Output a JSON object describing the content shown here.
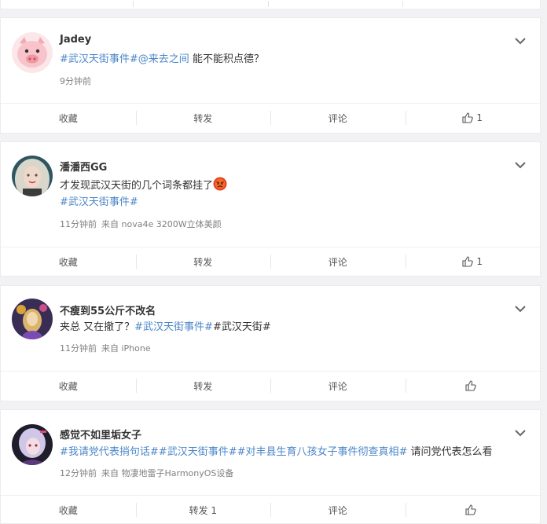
{
  "posts": [
    {
      "user": "Jadey",
      "text": [
        {
          "t": "#武汉天街事件#",
          "tag": true
        },
        {
          "t": "@来去之间",
          "tag": true
        },
        {
          "t": " 能不能积点德？",
          "tag": false
        }
      ],
      "time": "9分钟前",
      "source": "",
      "actions": {
        "fav": "收藏",
        "repost": "转发",
        "comment": "评论",
        "like": "1"
      }
    },
    {
      "user": "潘潘西GG",
      "text": [
        {
          "t": "才发现武汉天街的几个词条都挂了",
          "tag": false
        }
      ],
      "text2": "#武汉天街事件#",
      "emoji": "angry-face",
      "time": "11分钟前",
      "source": "来自 nova4e 3200W立体美颜",
      "actions": {
        "fav": "收藏",
        "repost": "转发",
        "comment": "评论",
        "like": "1"
      }
    },
    {
      "user": "不瘦到55公斤不改名",
      "text": [
        {
          "t": "夹总 又在撤了？",
          "tag": false
        },
        {
          "t": "#武汉天街事件#",
          "tag": true
        },
        {
          "t": "#武汉天街#",
          "tag": false
        }
      ],
      "time": "11分钟前",
      "source": "来自 iPhone",
      "actions": {
        "fav": "收藏",
        "repost": "转发",
        "comment": "评论",
        "like": ""
      }
    },
    {
      "user": "感觉不如里垢女子",
      "text": [
        {
          "t": "#我请党代表捎句话#",
          "tag": true
        },
        {
          "t": "#武汉天街事件#",
          "tag": true
        },
        {
          "t": "#对丰县生育八孩女子事件彻查真相#",
          "tag": true
        },
        {
          "t": " 请问党代表怎么看",
          "tag": false
        }
      ],
      "time": "12分钟前",
      "source": "来自 物凄地雷子HarmonyOS设备",
      "actions": {
        "fav": "收藏",
        "repost": "转发 1",
        "comment": "评论",
        "like": ""
      }
    }
  ],
  "colors": {
    "tag": "#4a86c9",
    "bg": "#f2f2f5",
    "meta": "#808080"
  }
}
